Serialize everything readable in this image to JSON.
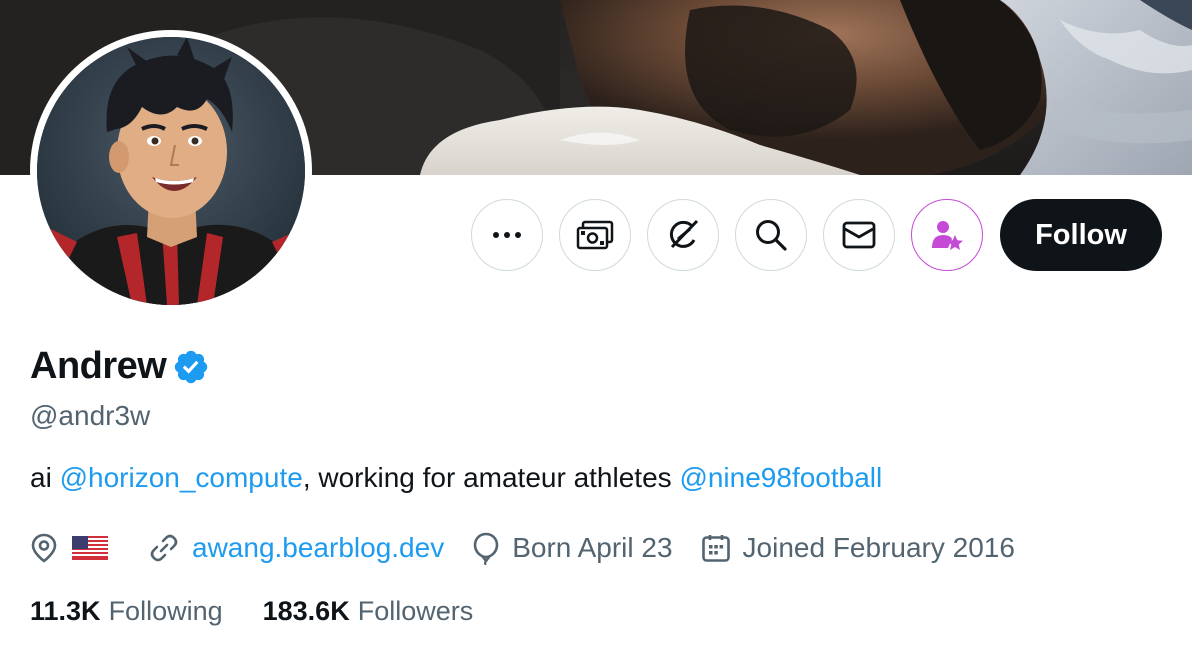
{
  "profile": {
    "display_name": "Andrew",
    "handle": "@andr3w",
    "verified": true,
    "bio": {
      "prefix": "ai ",
      "mention1": "@horizon_compute",
      "middle": ", working for amateur athletes ",
      "mention2": "@nine98football"
    },
    "meta": {
      "location_flag": "us-flag",
      "website": "awang.bearblog.dev",
      "birthday": "Born April 23",
      "joined": "Joined February 2016"
    },
    "stats": {
      "following_count": "11.3K",
      "following_label": "Following",
      "followers_count": "183.6K",
      "followers_label": "Followers"
    }
  },
  "actions": {
    "more_icon": "more-icon",
    "tip_icon": "money-icon",
    "grok_icon": "grok-icon",
    "search_icon": "search-icon",
    "message_icon": "message-icon",
    "subscribe_icon": "subscribe-icon",
    "follow_label": "Follow"
  },
  "colors": {
    "accent": "#1d9bf0",
    "text_primary": "#0f1419",
    "text_secondary": "#536471",
    "follow_bg": "#0f1419",
    "subscribe_accent": "#c54bd6",
    "verified": "#1d9bf0"
  }
}
